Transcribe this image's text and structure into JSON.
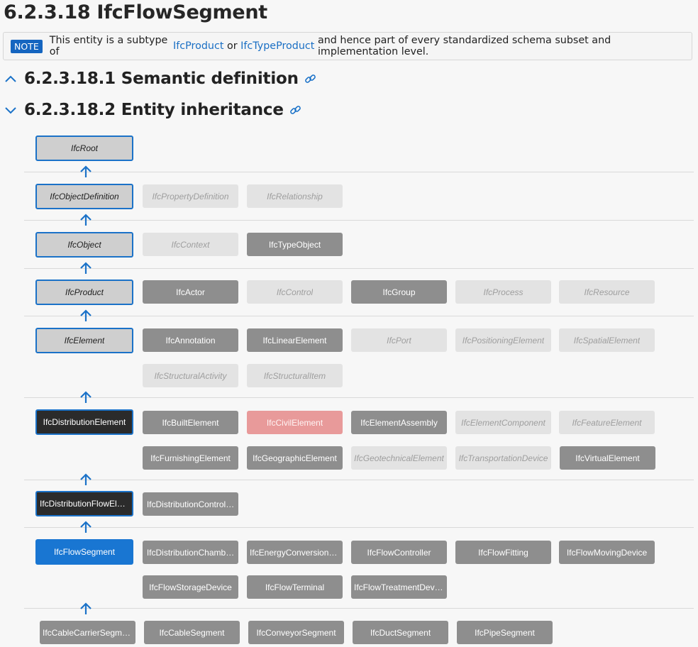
{
  "page": {
    "title": "6.2.3.18 IfcFlowSegment"
  },
  "note": {
    "badge": "NOTE",
    "text_before": "This entity is a subtype of",
    "link1": "IfcProduct",
    "text_mid": "or",
    "link2": "IfcTypeProduct",
    "text_after": "and hence part of every standardized schema subset and implementation level."
  },
  "sections": {
    "semantic": "6.2.3.18.1 Semantic definition",
    "inheritance": "6.2.3.18.2 Entity inheritance"
  },
  "colors": {
    "accent": "#1b72c8",
    "current": "#1976d2",
    "concrete": "#8e8e8e",
    "abstract": "#e3e3e3",
    "deprecated": "#e89a9a"
  },
  "inheritance": {
    "ancestors": [
      "IfcRoot",
      "IfcObjectDefinition",
      "IfcObject",
      "IfcProduct",
      "IfcElement",
      "IfcDistributionElement",
      "IfcDistributionFlowEle…",
      "IfcFlowSegment"
    ],
    "siblings": {
      "objectdefinition": [
        "IfcPropertyDefinition",
        "IfcRelationship"
      ],
      "object": [
        "IfcContext",
        "IfcTypeObject"
      ],
      "product": [
        "IfcActor",
        "IfcControl",
        "IfcGroup",
        "IfcProcess",
        "IfcResource"
      ],
      "element": [
        "IfcAnnotation",
        "IfcLinearElement",
        "IfcPort",
        "IfcPositioningElement",
        "IfcSpatialElement",
        "IfcStructuralActivity",
        "IfcStructuralItem"
      ],
      "distribution": [
        "IfcBuiltElement",
        "IfcCivilElement",
        "IfcElementAssembly",
        "IfcElementComponent",
        "IfcFeatureElement",
        "IfcFurnishingElement",
        "IfcGeographicElement",
        "IfcGeotechnicalElement",
        "IfcTransportationDevice",
        "IfcVirtualElement"
      ],
      "flow": [
        "IfcDistributionControl…"
      ],
      "segment": [
        "IfcDistributionChamb…",
        "IfcEnergyConversionD…",
        "IfcFlowController",
        "IfcFlowFitting",
        "IfcFlowMovingDevice",
        "IfcFlowStorageDevice",
        "IfcFlowTerminal",
        "IfcFlowTreatmentDevice"
      ]
    },
    "children": [
      "IfcCableCarrierSegment",
      "IfcCableSegment",
      "IfcConveyorSegment",
      "IfcDuctSegment",
      "IfcPipeSegment"
    ]
  }
}
